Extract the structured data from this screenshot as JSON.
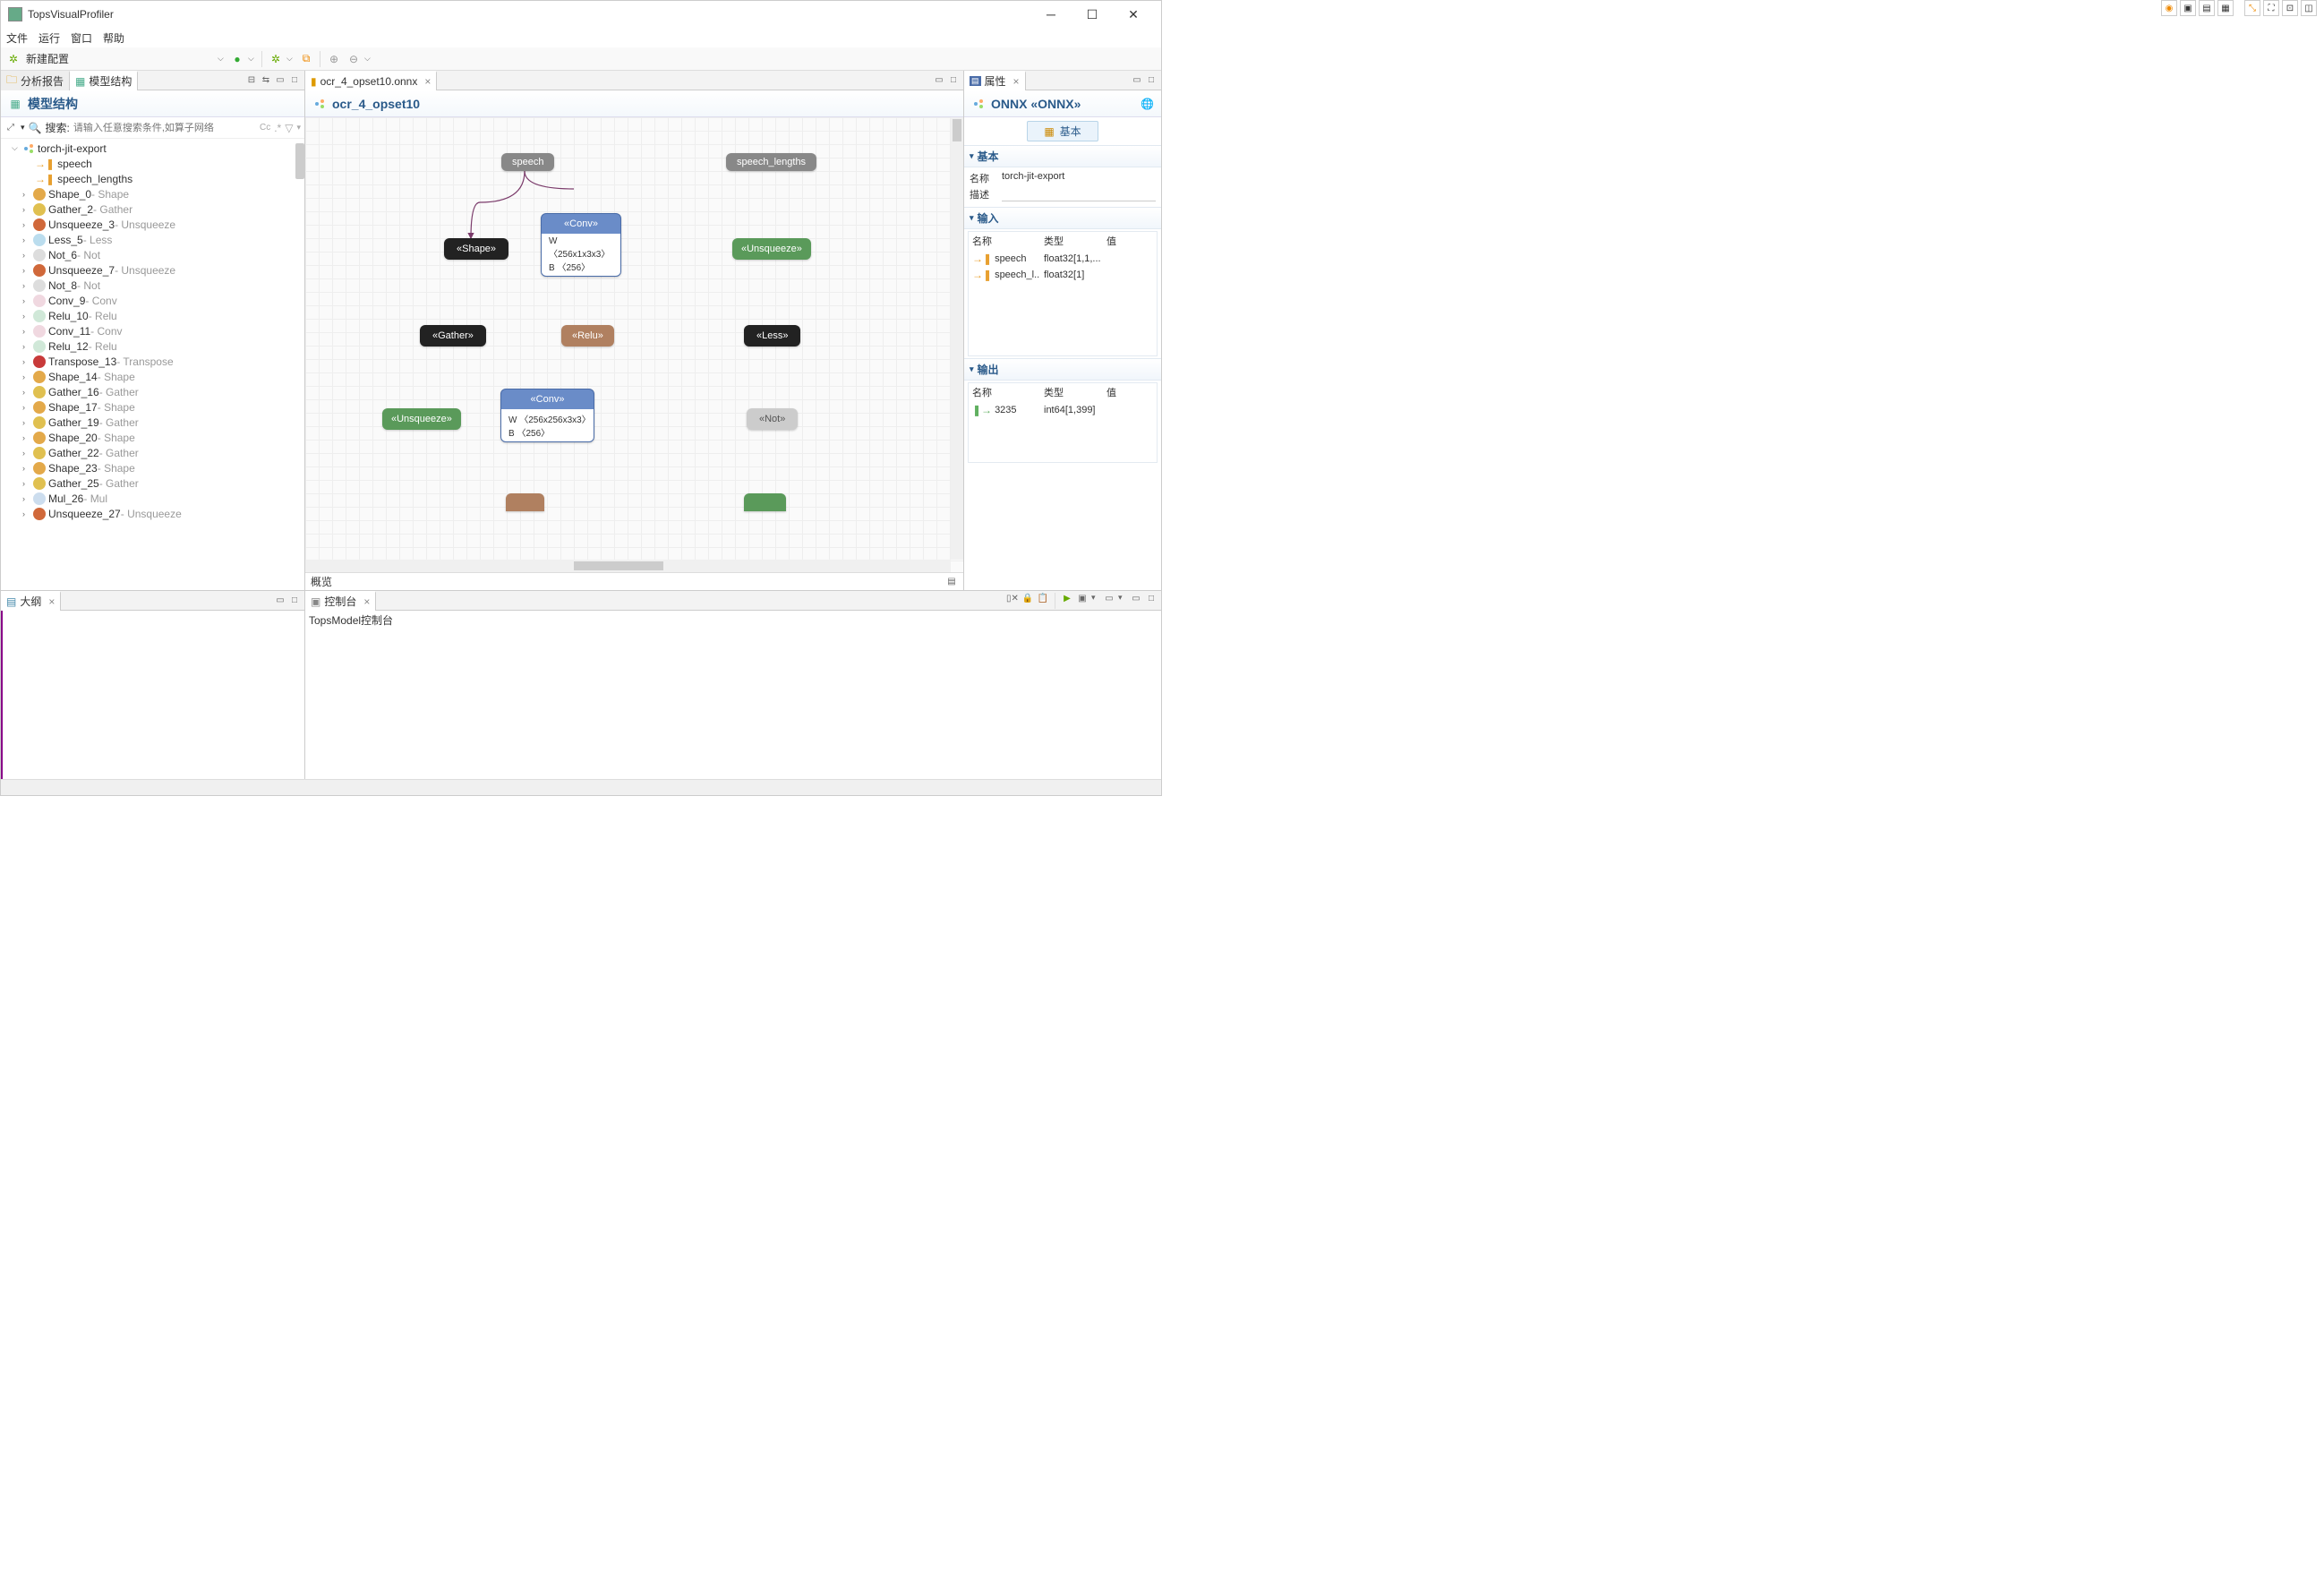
{
  "app": {
    "title": "TopsVisualProfiler"
  },
  "menu": {
    "file": "文件",
    "run": "运行",
    "window": "窗口",
    "help": "帮助"
  },
  "toolbar": {
    "new_config": "新建配置"
  },
  "left_panel": {
    "tab_report": "分析报告",
    "tab_model": "模型结构",
    "header": "模型结构",
    "search_label": "搜索:",
    "search_placeholder": "请输入任意搜索条件,如算子网络",
    "tree_root": "torch-jit-export",
    "inputs": [
      "speech",
      "speech_lengths"
    ],
    "ops": [
      {
        "name": "Shape_0",
        "type": "Shape",
        "icon": "ic-shape"
      },
      {
        "name": "Gather_2",
        "type": "Gather",
        "icon": "ic-gather"
      },
      {
        "name": "Unsqueeze_3",
        "type": "Unsqueeze",
        "icon": "ic-unsq"
      },
      {
        "name": "Less_5",
        "type": "Less",
        "icon": "ic-less"
      },
      {
        "name": "Not_6",
        "type": "Not",
        "icon": "ic-not"
      },
      {
        "name": "Unsqueeze_7",
        "type": "Unsqueeze",
        "icon": "ic-unsq"
      },
      {
        "name": "Not_8",
        "type": "Not",
        "icon": "ic-not"
      },
      {
        "name": "Conv_9",
        "type": "Conv",
        "icon": "ic-conv"
      },
      {
        "name": "Relu_10",
        "type": "Relu",
        "icon": "ic-relu"
      },
      {
        "name": "Conv_11",
        "type": "Conv",
        "icon": "ic-conv"
      },
      {
        "name": "Relu_12",
        "type": "Relu",
        "icon": "ic-relu"
      },
      {
        "name": "Transpose_13",
        "type": "Transpose",
        "icon": "ic-trans"
      },
      {
        "name": "Shape_14",
        "type": "Shape",
        "icon": "ic-shape"
      },
      {
        "name": "Gather_16",
        "type": "Gather",
        "icon": "ic-gather"
      },
      {
        "name": "Shape_17",
        "type": "Shape",
        "icon": "ic-shape"
      },
      {
        "name": "Gather_19",
        "type": "Gather",
        "icon": "ic-gather"
      },
      {
        "name": "Shape_20",
        "type": "Shape",
        "icon": "ic-shape"
      },
      {
        "name": "Gather_22",
        "type": "Gather",
        "icon": "ic-gather"
      },
      {
        "name": "Shape_23",
        "type": "Shape",
        "icon": "ic-shape"
      },
      {
        "name": "Gather_25",
        "type": "Gather",
        "icon": "ic-gather"
      },
      {
        "name": "Mul_26",
        "type": "Mul",
        "icon": "ic-mul"
      },
      {
        "name": "Unsqueeze_27",
        "type": "Unsqueeze",
        "icon": "ic-unsq"
      }
    ]
  },
  "center_panel": {
    "tab_file": "ocr_4_opset10.onnx",
    "header": "ocr_4_opset10",
    "overview": "概览",
    "nodes": {
      "speech": "speech",
      "speech_lengths": "speech_lengths",
      "shape": "«Shape»",
      "conv1_hdr": "«Conv»",
      "conv1_w": "W   〈256x1x3x3〉",
      "conv1_b": "B    〈256〉",
      "unsqueeze": "«Unsqueeze»",
      "gather": "«Gather»",
      "relu": "«Relu»",
      "less": "«Less»",
      "unsqueeze2": "«Unsqueeze»",
      "conv2_hdr": "«Conv»",
      "conv2_w": "W   〈256x256x3x3〉",
      "conv2_b": "B    〈256〉",
      "not": "«Not»"
    }
  },
  "right_panel": {
    "tab": "属性",
    "header": "ONNX «ONNX»",
    "pill": "基本",
    "sec_basic": "基本",
    "name_label": "名称",
    "name_value": "torch-jit-export",
    "desc_label": "描述",
    "sec_inputs": "输入",
    "col_name": "名称",
    "col_type": "类型",
    "col_value": "值",
    "in1_name": "speech",
    "in1_type": "float32[1,1,...",
    "in2_name": "speech_l...",
    "in2_type": "float32[1]",
    "sec_outputs": "输出",
    "out1_name": "3235",
    "out1_type": "int64[1,399]"
  },
  "outline": {
    "tab": "大纲"
  },
  "console": {
    "tab": "控制台",
    "text": "TopsModel控制台"
  }
}
